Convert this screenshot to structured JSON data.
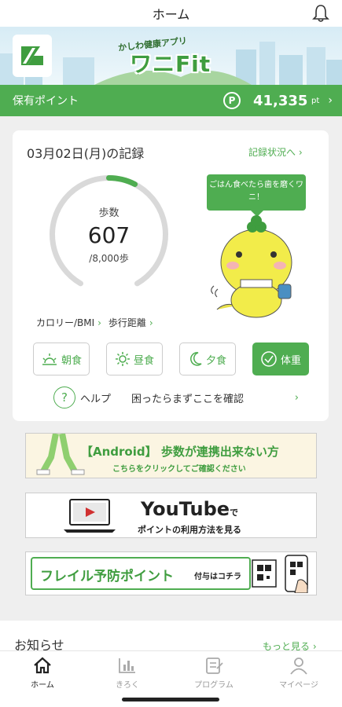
{
  "header": {
    "title": "ホーム",
    "bell_icon": "bell-icon"
  },
  "banner": {
    "app_sub": "かしわ健康アプリ",
    "app_name": "ワニFit"
  },
  "points": {
    "label": "保有ポイント",
    "mark": "P",
    "value": "41,335",
    "unit": "pt"
  },
  "record": {
    "date": "03月02日(月)の記録",
    "status_link": "記録状況へ",
    "steps_label": "歩数",
    "steps": "607",
    "goal": "/8,000歩",
    "progress": 0.076,
    "bubble": "ごはん食べたら歯を磨くワニ！",
    "links": [
      "カロリー/BMI",
      "歩行距離"
    ],
    "meals": [
      {
        "label": "朝食",
        "icon": "sunrise-icon",
        "active": false
      },
      {
        "label": "昼食",
        "icon": "sun-icon",
        "active": false
      },
      {
        "label": "夕食",
        "icon": "moon-icon",
        "active": false
      },
      {
        "label": "体重",
        "icon": "check-circle-icon",
        "active": true
      }
    ],
    "help_mark": "?",
    "help_label": "ヘルプ",
    "help_text": "困ったらまずここを確認"
  },
  "ads": {
    "android_title": "【Android】 歩数が連携出来ない方",
    "android_sub": "こちらをクリックしてご確認ください",
    "youtube_title": "YouTube",
    "youtube_de": "で",
    "youtube_sub": "ポイントの利用方法を見る",
    "frail_title": "フレイル予防ポイント",
    "frail_sub": "付与はコチラ"
  },
  "notice": {
    "title": "お知らせ",
    "more": "もっと見る"
  },
  "tabs": [
    {
      "label": "ホーム",
      "icon": "home-icon",
      "active": true
    },
    {
      "label": "きろく",
      "icon": "chart-icon",
      "active": false
    },
    {
      "label": "プログラム",
      "icon": "program-icon",
      "active": false
    },
    {
      "label": "マイページ",
      "icon": "person-icon",
      "active": false
    }
  ],
  "colors": {
    "accent": "#4fad51",
    "ring_bg": "#d9d9d9"
  }
}
